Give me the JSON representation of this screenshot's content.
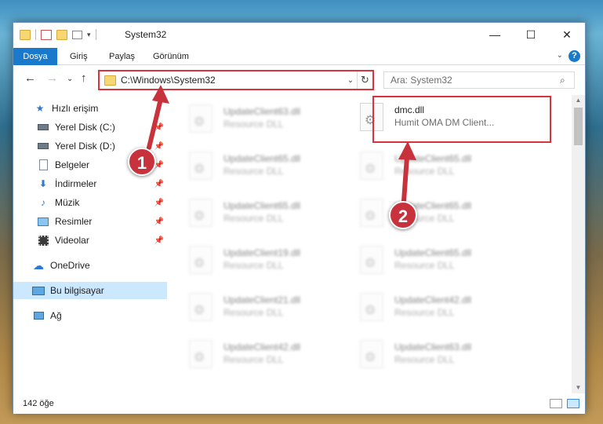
{
  "window": {
    "title": "System32",
    "minimize": "—",
    "maximize": "☐",
    "close": "✕"
  },
  "ribbon": {
    "tabs": [
      "Dosya",
      "Giriş",
      "Paylaş",
      "Görünüm"
    ],
    "help": "?",
    "collapse": "⌄"
  },
  "nav": {
    "back": "←",
    "forward": "→",
    "recent": "⌄",
    "up": "↑",
    "address": "C:\\Windows\\System32",
    "address_dropdown": "⌄",
    "refresh": "↻",
    "search_placeholder": "Ara: System32",
    "search_icon": "⌕"
  },
  "sidebar": {
    "items": [
      {
        "label": "Hızlı erişim",
        "icon": "star-icon",
        "pinned": false
      },
      {
        "label": "Yerel Disk (C:)",
        "icon": "drive-icon",
        "pinned": true
      },
      {
        "label": "Yerel Disk (D:)",
        "icon": "drive-icon",
        "pinned": true
      },
      {
        "label": "Belgeler",
        "icon": "document-icon",
        "pinned": true
      },
      {
        "label": "İndirmeler",
        "icon": "download-icon",
        "pinned": true
      },
      {
        "label": "Müzik",
        "icon": "music-icon",
        "pinned": true
      },
      {
        "label": "Resimler",
        "icon": "pictures-icon",
        "pinned": true
      },
      {
        "label": "Videolar",
        "icon": "video-icon",
        "pinned": true
      },
      {
        "label": "OneDrive",
        "icon": "cloud-icon",
        "pinned": false
      },
      {
        "label": "Bu bilgisayar",
        "icon": "computer-icon",
        "pinned": false,
        "selected": true
      },
      {
        "label": "Ağ",
        "icon": "network-icon",
        "pinned": false
      }
    ]
  },
  "files": {
    "left": [
      {
        "name": "UpdateClient63.dll",
        "desc": "Resource DLL"
      },
      {
        "name": "UpdateClient65.dll",
        "desc": "Resource DLL"
      },
      {
        "name": "UpdateClient65.dll",
        "desc": "Resource DLL"
      },
      {
        "name": "UpdateClient19.dll",
        "desc": "Resource DLL"
      },
      {
        "name": "UpdateClient21.dll",
        "desc": "Resource DLL"
      },
      {
        "name": "UpdateClient42.dll",
        "desc": "Resource DLL"
      }
    ],
    "right": [
      {
        "name": "dmc.dll",
        "desc": "Humit OMA DM Client..."
      },
      {
        "name": "UpdateClient65.dll",
        "desc": "Resource DLL"
      },
      {
        "name": "UpdateClient65.dll",
        "desc": "Resource DLL"
      },
      {
        "name": "UpdateClient65.dll",
        "desc": "Resource DLL"
      },
      {
        "name": "UpdateClient42.dll",
        "desc": "Resource DLL"
      },
      {
        "name": "UpdateClient63.dll",
        "desc": "Resource DLL"
      }
    ]
  },
  "status": {
    "count": "142 öğe"
  },
  "markers": [
    "1",
    "2"
  ],
  "colors": {
    "highlight": "#d9333f",
    "marker": "#c8323c",
    "accent": "#1979ca"
  }
}
